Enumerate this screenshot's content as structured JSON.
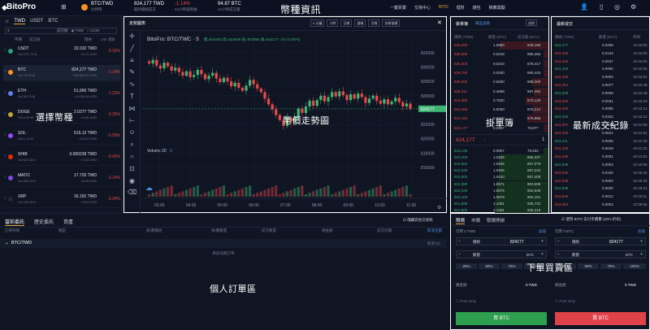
{
  "header": {
    "brand": "BitoPro",
    "pair": "BTC/TWD",
    "pair_sub": "比特幣",
    "last_price": "824,177 TWD",
    "last_price_sub": "最新價格成交",
    "change_pct": "-1.14%",
    "change_label": "24小時漲跌幅",
    "volume": "94.87 BTC",
    "volume_label": "24小時成交量",
    "nav": [
      "一鍵買賣",
      "交易中心",
      "BITO",
      "理財",
      "錢包",
      "推薦獎勵"
    ],
    "nav_active_color": "#e9a23b"
  },
  "overlays": {
    "coin_info": "幣種資訊",
    "select_coin": "選擇幣種",
    "price_trend": "幣價走勢圖",
    "order_book": "掛單簿",
    "latest_trades": "最新成交紀錄",
    "place_order": "下單買賣區",
    "personal_orders": "個人訂單區"
  },
  "market": {
    "tabs": [
      "TWD",
      "USDT",
      "BTC"
    ],
    "filter_label": "成交額",
    "radio": [
      "TWD",
      "COIN"
    ],
    "columns": [
      "幣種",
      "成交額",
      "價格",
      "24h 漲跌"
    ],
    "rows": [
      {
        "name": "USDT",
        "vol": "Vol 272.72 M",
        "price": "32.032 TWD",
        "price_twd": "≈1.01 USD",
        "change": "-0.16%",
        "color": "#26a17b"
      },
      {
        "name": "BTC",
        "vol": "Vol 78.19 M",
        "price": "824,177 TWD",
        "price_twd": "≈25,889.02 USD",
        "change": "-1.14%",
        "color": "#f7931a"
      },
      {
        "name": "ETH",
        "vol": "Vol 35.79 M",
        "price": "51,900 TWD",
        "price_twd": "≈1,630.28 USD",
        "change": "-1.22%",
        "color": "#627eea"
      },
      {
        "name": "DOGE",
        "vol": "Vol 2.95 M",
        "price": "2.0277 TWD",
        "price_twd": "≈0.06 USD",
        "change": "-0.26%",
        "color": "#c2a633"
      },
      {
        "name": "SOL",
        "vol": "Vol 1.11 M",
        "price": "615.12 TWD",
        "price_twd": "≈19.32 USD",
        "change": "-0.58%",
        "color": "#9945ff"
      },
      {
        "name": "SHIB",
        "vol": "Vol 619.36 K",
        "price": "0.000239 TWD",
        "price_twd": "≈0.00 USD",
        "change": "-0.42%",
        "color": "#e42d04"
      },
      {
        "name": "MATIC",
        "vol": "Vol 530.52 K",
        "price": "17.720 TWD",
        "price_twd": "≈0.56 USD",
        "change": "-3.14%",
        "color": "#8247e5"
      },
      {
        "name": "XRP",
        "vol": "Vol 443.40 K",
        "price": "16.191 TWD",
        "price_twd": "≈0.51 USD",
        "change": "-0.24%",
        "color": "#23292f"
      }
    ]
  },
  "chart": {
    "title": "走勢圖表",
    "interval": "5 分鐘",
    "buttons": [
      "小時",
      "日線",
      "週線",
      "月線",
      "技術指標"
    ],
    "legend": "BitoPro: BTC/TWD · 5",
    "ohlc": "開=824463 高=824638 低=823954 收=824177 -24 (-0.00%)",
    "volume_label": "Volume 20",
    "volume_value": "0",
    "last_tag": "824177"
  },
  "chart_data": {
    "type": "candlestick",
    "x_ticks": [
      "03:00",
      "04:00",
      "05:00",
      "06:00",
      "07:00",
      "08:00",
      "09:00",
      "10:00",
      "11:00"
    ],
    "y_ticks": [
      "832000",
      "830000",
      "828000",
      "826000",
      "824000",
      "822000",
      "820000",
      "818000",
      "816000"
    ],
    "ylim": [
      816000,
      833000
    ],
    "closes": [
      830500,
      831000,
      830200,
      829800,
      830600,
      830100,
      829500,
      829900,
      829300,
      828800,
      829400,
      828600,
      828900,
      829600,
      829000,
      828300,
      828800,
      829200,
      828400,
      827900,
      828500,
      828000,
      827300,
      827800,
      827100,
      826700,
      827400,
      828200,
      827600,
      827000,
      826500,
      825600,
      824800,
      824100,
      823300,
      822600,
      821800,
      822900,
      822300,
      823100,
      824200,
      823600,
      824500,
      825300,
      824600,
      825400,
      826000,
      825200,
      825800,
      826500,
      825900,
      826600,
      826100,
      825400,
      826200,
      825600,
      826300,
      825800,
      825000,
      825600,
      826000,
      825300,
      824900,
      825500,
      824800,
      825200,
      825700,
      825100,
      824500,
      824900,
      824177
    ],
    "up_color": "#3fb573",
    "down_color": "#e9484a"
  },
  "orderbook": {
    "title": "掛單簿",
    "sub": "價差查看",
    "agg": "合併",
    "cols": [
      "價格 (TWD)",
      "數量 (BTC)",
      "成交額 (BTC)"
    ],
    "asks": [
      [
        "825,993",
        "1.5960",
        "949,165"
      ],
      [
        "825,880",
        "0.0218",
        "685,456"
      ],
      [
        "825,800",
        "0.0210",
        "678,417"
      ],
      [
        "825,760",
        "0.0200",
        "680,443"
      ],
      [
        "825,600",
        "0.5500",
        "698,200"
      ],
      [
        "825,311",
        "0.4688",
        "697,492"
      ],
      [
        "824,866",
        "0.7500",
        "670,129"
      ],
      [
        "824,580",
        "0.5000",
        "676,212"
      ],
      [
        "824,494",
        "0.6920",
        "676,886"
      ],
      [
        "824,177",
        "0.0957",
        "78,877"
      ]
    ],
    "mid_price": "824,177",
    "mid_tag": "1",
    "bids": [
      [
        "823,145",
        "0.0957",
        "78,832"
      ],
      [
        "823,000",
        "1.0405",
        "856,337"
      ],
      [
        "822,952",
        "1.0405",
        "857,079"
      ],
      [
        "822,826",
        "1.0405",
        "857,244"
      ],
      [
        "822,602",
        "1.0410",
        "857,409"
      ],
      [
        "822,380",
        "1.0971",
        "903,699"
      ],
      [
        "822,229",
        "1.0975",
        "902,938"
      ],
      [
        "822,100",
        "1.0979",
        "904,101"
      ],
      [
        "821,988",
        "1.1361",
        "935,722"
      ],
      [
        "821,800",
        "1.1361",
        "936,216"
      ]
    ]
  },
  "trades": {
    "title": "最新成交",
    "cols": [
      "價格 (TWD)",
      "數量 (BTC)",
      "時間"
    ],
    "rows": [
      [
        "824,177",
        "0.0299",
        "10:43:00"
      ],
      [
        "824,200",
        "0.0134",
        "10:43:00"
      ],
      [
        "824,440",
        "0.0047",
        "10:43:00"
      ],
      [
        "824,440",
        "0.0050",
        "10:42:55"
      ],
      [
        "824,440",
        "0.0002",
        "10:42:51"
      ],
      [
        "824,481",
        "0.0077",
        "10:42:49"
      ],
      [
        "824,500",
        "0.0008",
        "10:42:48"
      ],
      [
        "824,500",
        "0.0031",
        "10:42:33"
      ],
      [
        "824,000",
        "0.0085",
        "10:42:21"
      ],
      [
        "824,033",
        "0.0102",
        "10:42:12"
      ],
      [
        "824,007",
        "0.0038",
        "10:41:55"
      ],
      [
        "824,100",
        "0.0021",
        "10:41:51"
      ],
      [
        "824,211",
        "0.0006",
        "10:41:40"
      ],
      [
        "824,330",
        "0.0018",
        "10:41:22"
      ],
      [
        "824,538",
        "0.0001",
        "10:41:01"
      ],
      [
        "824,538",
        "0.0004",
        "10:40:59"
      ],
      [
        "824,636",
        "0.0100",
        "10:40:42"
      ],
      [
        "824,538",
        "0.0002",
        "10:40:33"
      ],
      [
        "824,548",
        "0.0020",
        "10:40:21"
      ],
      [
        "824,548",
        "0.0012",
        "10:40:11"
      ],
      [
        "824,583",
        "0.0003",
        "10:39:56"
      ]
    ]
  },
  "orders": {
    "tabs": [
      "當前委託",
      "歷史委託",
      "資產"
    ],
    "hide_other": "隱藏其他交易對",
    "cols": [
      "訂單時間",
      "類型",
      "買/賣價格",
      "買/賣數量",
      "成交數量",
      "總金額",
      "成交均價",
      "取消全部"
    ],
    "pair_row": "BTC/TWD",
    "cancel_label": "取消 (0)",
    "empty": "目前尚無訂單"
  },
  "form": {
    "tabs": [
      "限價",
      "市價",
      "取價停損"
    ],
    "bito_fee": "使用 BITO 支付手續費 (20% 折扣)",
    "buy_avail": "可用 0 TWD",
    "sell_avail": "可用 0 BTC",
    "deposit": "加值",
    "price_label": "價格",
    "buy_price": "824177",
    "sell_price": "824177",
    "qty_label": "數量",
    "qty_unit": "BTC",
    "pcts": [
      "25%",
      "50%",
      "75%",
      "100%"
    ],
    "total_label": "總金額",
    "total_value": "0 TWD",
    "post_only": "Post Only",
    "buy_btn": "買 BTC",
    "sell_btn": "賣 BTC",
    "buy_color": "#2e9e4f",
    "sell_color": "#e0424a"
  }
}
